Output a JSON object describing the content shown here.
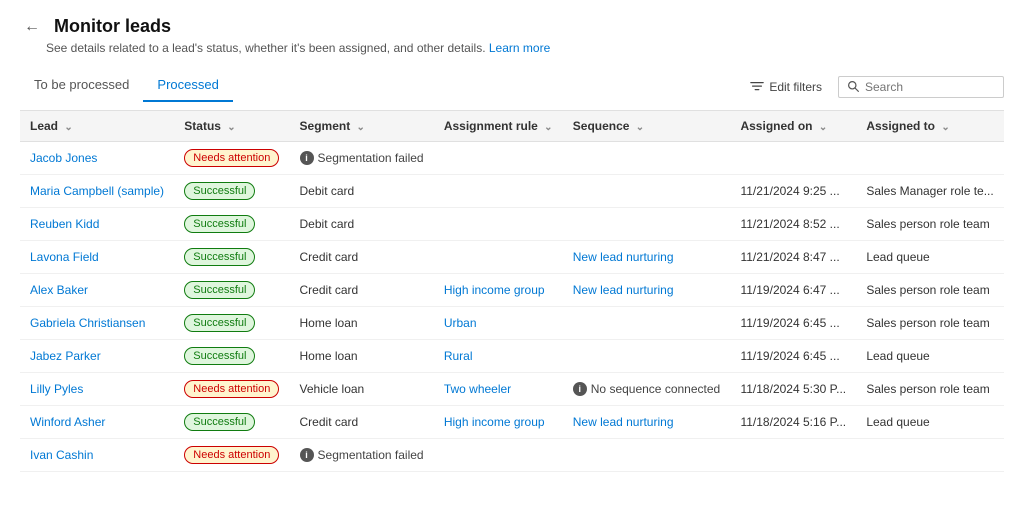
{
  "header": {
    "title": "Monitor leads",
    "subtitle": "See details related to a lead's status, whether it's been assigned, and other details.",
    "learn_more": "Learn more"
  },
  "tabs": [
    {
      "id": "to-be-processed",
      "label": "To be processed",
      "active": false
    },
    {
      "id": "processed",
      "label": "Processed",
      "active": true
    }
  ],
  "toolbar": {
    "edit_filters": "Edit filters",
    "search_placeholder": "Search"
  },
  "columns": [
    {
      "id": "lead",
      "label": "Lead"
    },
    {
      "id": "status",
      "label": "Status"
    },
    {
      "id": "segment",
      "label": "Segment"
    },
    {
      "id": "assignment_rule",
      "label": "Assignment rule"
    },
    {
      "id": "sequence",
      "label": "Sequence"
    },
    {
      "id": "assigned_on",
      "label": "Assigned on"
    },
    {
      "id": "assigned_to",
      "label": "Assigned to"
    }
  ],
  "rows": [
    {
      "lead": "Jacob Jones",
      "status": "Needs attention",
      "status_type": "attention",
      "segment": "Segmentation failed",
      "segment_type": "failed",
      "assignment_rule": "",
      "sequence": "",
      "sequence_type": "normal",
      "assigned_on": "",
      "assigned_to": ""
    },
    {
      "lead": "Maria Campbell (sample)",
      "status": "Successful",
      "status_type": "success",
      "segment": "Debit card",
      "segment_type": "link",
      "assignment_rule": "",
      "sequence": "",
      "sequence_type": "normal",
      "assigned_on": "11/21/2024 9:25 ...",
      "assigned_to": "Sales Manager role te..."
    },
    {
      "lead": "Reuben Kidd",
      "status": "Successful",
      "status_type": "success",
      "segment": "Debit card",
      "segment_type": "link",
      "assignment_rule": "",
      "sequence": "",
      "sequence_type": "normal",
      "assigned_on": "11/21/2024 8:52 ...",
      "assigned_to": "Sales person role team"
    },
    {
      "lead": "Lavona Field",
      "status": "Successful",
      "status_type": "success",
      "segment": "Credit card",
      "segment_type": "link",
      "assignment_rule": "",
      "sequence": "New lead nurturing",
      "sequence_type": "link",
      "assigned_on": "11/21/2024 8:47 ...",
      "assigned_to": "Lead queue"
    },
    {
      "lead": "Alex Baker",
      "status": "Successful",
      "status_type": "success",
      "segment": "Credit card",
      "segment_type": "link",
      "assignment_rule": "High income group",
      "sequence": "New lead nurturing",
      "sequence_type": "link",
      "assigned_on": "11/19/2024 6:47 ...",
      "assigned_to": "Sales person role team"
    },
    {
      "lead": "Gabriela Christiansen",
      "status": "Successful",
      "status_type": "success",
      "segment": "Home loan",
      "segment_type": "link",
      "assignment_rule": "Urban",
      "sequence": "",
      "sequence_type": "normal",
      "assigned_on": "11/19/2024 6:45 ...",
      "assigned_to": "Sales person role team"
    },
    {
      "lead": "Jabez Parker",
      "status": "Successful",
      "status_type": "success",
      "segment": "Home loan",
      "segment_type": "link",
      "assignment_rule": "Rural",
      "sequence": "",
      "sequence_type": "normal",
      "assigned_on": "11/19/2024 6:45 ...",
      "assigned_to": "Lead queue"
    },
    {
      "lead": "Lilly Pyles",
      "status": "Needs attention",
      "status_type": "attention",
      "segment": "Vehicle loan",
      "segment_type": "link",
      "assignment_rule": "Two wheeler",
      "sequence": "No sequence connected",
      "sequence_type": "warning",
      "assigned_on": "11/18/2024 5:30 P...",
      "assigned_to": "Sales person role team"
    },
    {
      "lead": "Winford Asher",
      "status": "Successful",
      "status_type": "success",
      "segment": "Credit card",
      "segment_type": "link",
      "assignment_rule": "High income group",
      "sequence": "New lead nurturing",
      "sequence_type": "link",
      "assigned_on": "11/18/2024 5:16 P...",
      "assigned_to": "Lead queue"
    },
    {
      "lead": "Ivan Cashin",
      "status": "Needs attention",
      "status_type": "attention",
      "segment": "Segmentation failed",
      "segment_type": "failed",
      "assignment_rule": "",
      "sequence": "",
      "sequence_type": "normal",
      "assigned_on": "",
      "assigned_to": ""
    }
  ]
}
